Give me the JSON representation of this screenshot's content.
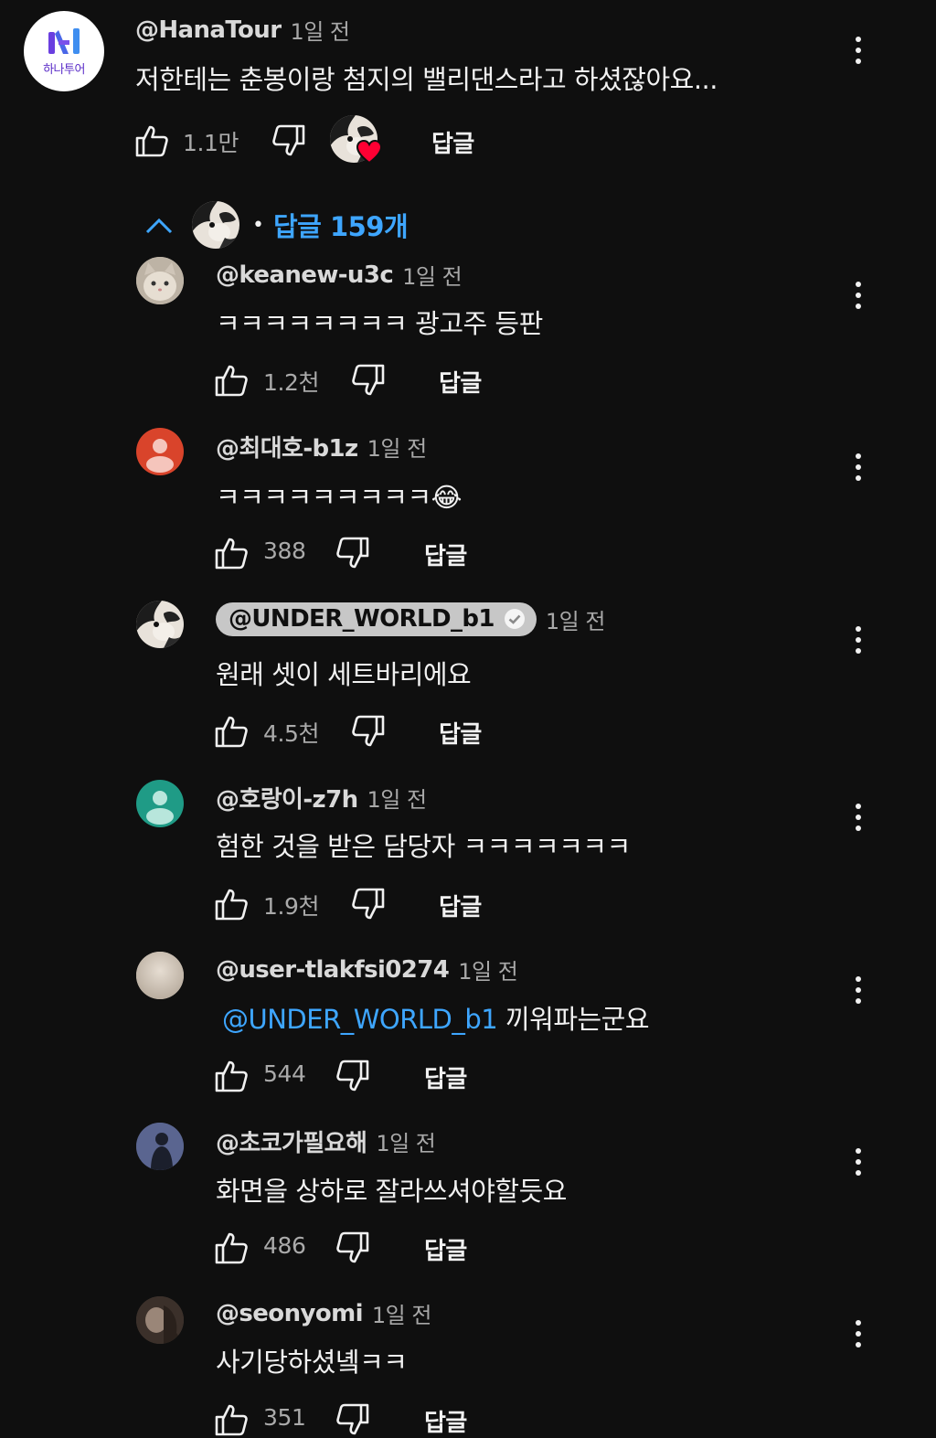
{
  "top_comment": {
    "avatar_label": "하나투어",
    "author": "@HanaTour",
    "time": "1일 전",
    "text": "저한테는 춘봉이랑 첨지의 밸리댄스라고 하셨잖아요...",
    "likes": "1.1만",
    "reply_label": "답글"
  },
  "replies_toggle": {
    "separator": "•",
    "label": "답글 159개"
  },
  "replies": [
    {
      "author": "@keanew-u3c",
      "time": "1일 전",
      "text": "ㅋㅋㅋㅋㅋㅋㅋㅋ 광고주 등판",
      "likes": "1.2천",
      "reply_label": "답글"
    },
    {
      "author": "@최대호-b1z",
      "time": "1일 전",
      "text": "ㅋㅋㅋㅋㅋㅋㅋㅋㅋ😂",
      "likes": "388",
      "reply_label": "답글"
    },
    {
      "author": "@UNDER_WORLD_b1",
      "time": "1일 전",
      "text": "원래 셋이 세트바리에요",
      "likes": "4.5천",
      "reply_label": "답글",
      "verified": true
    },
    {
      "author": "@호랑이-z7h",
      "time": "1일 전",
      "text": "험한 것을 받은 담당자 ㅋㅋㅋㅋㅋㅋㅋ",
      "likes": "1.9천",
      "reply_label": "답글"
    },
    {
      "author": "@user-tlakfsi0274",
      "time": "1일 전",
      "mention": "@UNDER_WORLD_b1",
      "text": " 끼워파는군요",
      "likes": "544",
      "reply_label": "답글"
    },
    {
      "author": "@초코가필요해",
      "time": "1일 전",
      "text": "화면을 상하로 잘라쓰셔야할듯요",
      "likes": "486",
      "reply_label": "답글"
    },
    {
      "author": "@seonyomi",
      "time": "1일 전",
      "text": "사기당하셨녴ㅋㅋ",
      "likes": "351",
      "reply_label": "답글"
    }
  ],
  "colors": {
    "background": "#0f0f0f",
    "link": "#3ea6ff",
    "heart": "#ff0033",
    "avatar_red": "#d9442b",
    "avatar_teal": "#1f9b86"
  },
  "icons": [
    "like-icon",
    "dislike-icon",
    "more-vert-icon",
    "chevron-up-icon",
    "heart-icon",
    "verified-icon"
  ]
}
